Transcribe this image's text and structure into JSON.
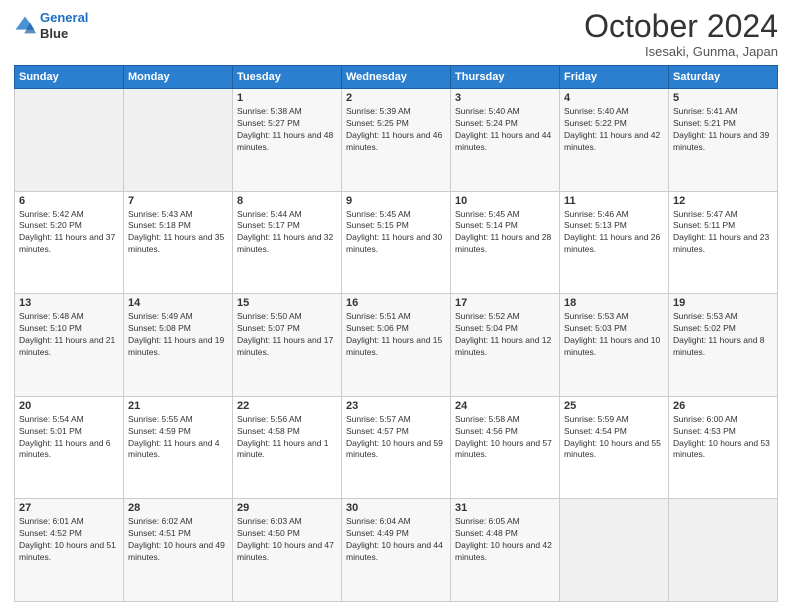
{
  "header": {
    "logo_line1": "General",
    "logo_line2": "Blue",
    "month": "October 2024",
    "location": "Isesaki, Gunma, Japan"
  },
  "weekdays": [
    "Sunday",
    "Monday",
    "Tuesday",
    "Wednesday",
    "Thursday",
    "Friday",
    "Saturday"
  ],
  "weeks": [
    [
      {
        "day": "",
        "sunrise": "",
        "sunset": "",
        "daylight": ""
      },
      {
        "day": "",
        "sunrise": "",
        "sunset": "",
        "daylight": ""
      },
      {
        "day": "1",
        "sunrise": "Sunrise: 5:38 AM",
        "sunset": "Sunset: 5:27 PM",
        "daylight": "Daylight: 11 hours and 48 minutes."
      },
      {
        "day": "2",
        "sunrise": "Sunrise: 5:39 AM",
        "sunset": "Sunset: 5:25 PM",
        "daylight": "Daylight: 11 hours and 46 minutes."
      },
      {
        "day": "3",
        "sunrise": "Sunrise: 5:40 AM",
        "sunset": "Sunset: 5:24 PM",
        "daylight": "Daylight: 11 hours and 44 minutes."
      },
      {
        "day": "4",
        "sunrise": "Sunrise: 5:40 AM",
        "sunset": "Sunset: 5:22 PM",
        "daylight": "Daylight: 11 hours and 42 minutes."
      },
      {
        "day": "5",
        "sunrise": "Sunrise: 5:41 AM",
        "sunset": "Sunset: 5:21 PM",
        "daylight": "Daylight: 11 hours and 39 minutes."
      }
    ],
    [
      {
        "day": "6",
        "sunrise": "Sunrise: 5:42 AM",
        "sunset": "Sunset: 5:20 PM",
        "daylight": "Daylight: 11 hours and 37 minutes."
      },
      {
        "day": "7",
        "sunrise": "Sunrise: 5:43 AM",
        "sunset": "Sunset: 5:18 PM",
        "daylight": "Daylight: 11 hours and 35 minutes."
      },
      {
        "day": "8",
        "sunrise": "Sunrise: 5:44 AM",
        "sunset": "Sunset: 5:17 PM",
        "daylight": "Daylight: 11 hours and 32 minutes."
      },
      {
        "day": "9",
        "sunrise": "Sunrise: 5:45 AM",
        "sunset": "Sunset: 5:15 PM",
        "daylight": "Daylight: 11 hours and 30 minutes."
      },
      {
        "day": "10",
        "sunrise": "Sunrise: 5:45 AM",
        "sunset": "Sunset: 5:14 PM",
        "daylight": "Daylight: 11 hours and 28 minutes."
      },
      {
        "day": "11",
        "sunrise": "Sunrise: 5:46 AM",
        "sunset": "Sunset: 5:13 PM",
        "daylight": "Daylight: 11 hours and 26 minutes."
      },
      {
        "day": "12",
        "sunrise": "Sunrise: 5:47 AM",
        "sunset": "Sunset: 5:11 PM",
        "daylight": "Daylight: 11 hours and 23 minutes."
      }
    ],
    [
      {
        "day": "13",
        "sunrise": "Sunrise: 5:48 AM",
        "sunset": "Sunset: 5:10 PM",
        "daylight": "Daylight: 11 hours and 21 minutes."
      },
      {
        "day": "14",
        "sunrise": "Sunrise: 5:49 AM",
        "sunset": "Sunset: 5:08 PM",
        "daylight": "Daylight: 11 hours and 19 minutes."
      },
      {
        "day": "15",
        "sunrise": "Sunrise: 5:50 AM",
        "sunset": "Sunset: 5:07 PM",
        "daylight": "Daylight: 11 hours and 17 minutes."
      },
      {
        "day": "16",
        "sunrise": "Sunrise: 5:51 AM",
        "sunset": "Sunset: 5:06 PM",
        "daylight": "Daylight: 11 hours and 15 minutes."
      },
      {
        "day": "17",
        "sunrise": "Sunrise: 5:52 AM",
        "sunset": "Sunset: 5:04 PM",
        "daylight": "Daylight: 11 hours and 12 minutes."
      },
      {
        "day": "18",
        "sunrise": "Sunrise: 5:53 AM",
        "sunset": "Sunset: 5:03 PM",
        "daylight": "Daylight: 11 hours and 10 minutes."
      },
      {
        "day": "19",
        "sunrise": "Sunrise: 5:53 AM",
        "sunset": "Sunset: 5:02 PM",
        "daylight": "Daylight: 11 hours and 8 minutes."
      }
    ],
    [
      {
        "day": "20",
        "sunrise": "Sunrise: 5:54 AM",
        "sunset": "Sunset: 5:01 PM",
        "daylight": "Daylight: 11 hours and 6 minutes."
      },
      {
        "day": "21",
        "sunrise": "Sunrise: 5:55 AM",
        "sunset": "Sunset: 4:59 PM",
        "daylight": "Daylight: 11 hours and 4 minutes."
      },
      {
        "day": "22",
        "sunrise": "Sunrise: 5:56 AM",
        "sunset": "Sunset: 4:58 PM",
        "daylight": "Daylight: 11 hours and 1 minute."
      },
      {
        "day": "23",
        "sunrise": "Sunrise: 5:57 AM",
        "sunset": "Sunset: 4:57 PM",
        "daylight": "Daylight: 10 hours and 59 minutes."
      },
      {
        "day": "24",
        "sunrise": "Sunrise: 5:58 AM",
        "sunset": "Sunset: 4:56 PM",
        "daylight": "Daylight: 10 hours and 57 minutes."
      },
      {
        "day": "25",
        "sunrise": "Sunrise: 5:59 AM",
        "sunset": "Sunset: 4:54 PM",
        "daylight": "Daylight: 10 hours and 55 minutes."
      },
      {
        "day": "26",
        "sunrise": "Sunrise: 6:00 AM",
        "sunset": "Sunset: 4:53 PM",
        "daylight": "Daylight: 10 hours and 53 minutes."
      }
    ],
    [
      {
        "day": "27",
        "sunrise": "Sunrise: 6:01 AM",
        "sunset": "Sunset: 4:52 PM",
        "daylight": "Daylight: 10 hours and 51 minutes."
      },
      {
        "day": "28",
        "sunrise": "Sunrise: 6:02 AM",
        "sunset": "Sunset: 4:51 PM",
        "daylight": "Daylight: 10 hours and 49 minutes."
      },
      {
        "day": "29",
        "sunrise": "Sunrise: 6:03 AM",
        "sunset": "Sunset: 4:50 PM",
        "daylight": "Daylight: 10 hours and 47 minutes."
      },
      {
        "day": "30",
        "sunrise": "Sunrise: 6:04 AM",
        "sunset": "Sunset: 4:49 PM",
        "daylight": "Daylight: 10 hours and 44 minutes."
      },
      {
        "day": "31",
        "sunrise": "Sunrise: 6:05 AM",
        "sunset": "Sunset: 4:48 PM",
        "daylight": "Daylight: 10 hours and 42 minutes."
      },
      {
        "day": "",
        "sunrise": "",
        "sunset": "",
        "daylight": ""
      },
      {
        "day": "",
        "sunrise": "",
        "sunset": "",
        "daylight": ""
      }
    ]
  ]
}
